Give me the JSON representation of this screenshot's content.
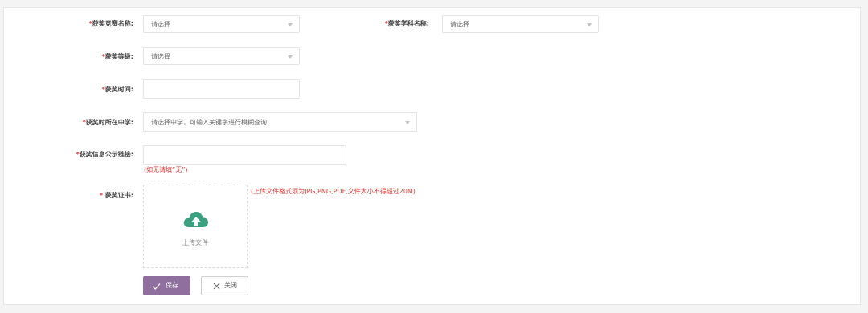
{
  "form": {
    "required_mark": "*",
    "competition": {
      "label": "获奖竞赛名称:",
      "placeholder": "请选择"
    },
    "subject": {
      "label": "获奖学科名称:",
      "placeholder": "请选择"
    },
    "level": {
      "label": "获奖等级:",
      "placeholder": "请选择"
    },
    "time": {
      "label": "获奖时间:",
      "value": ""
    },
    "school": {
      "label": "获奖时所在中学:",
      "placeholder": "请选择中学，可输入关键字进行模糊查询"
    },
    "link": {
      "label": "获奖信息公示链接:",
      "value": "",
      "hint": "(如无请填“无”)"
    },
    "certificate": {
      "label": "获奖证书:",
      "upload_text": "上传文件",
      "hint": "(上传文件格式须为JPG,PNG,PDF,文件大小不得超过20M)"
    }
  },
  "actions": {
    "save": "保存",
    "close": "关闭"
  },
  "colors": {
    "primary": "#8e6f9e",
    "required": "#e53935",
    "upload_icon": "#3aa07f"
  },
  "icons": {
    "save": "check-icon",
    "close": "close-icon",
    "upload": "cloud-upload-icon"
  }
}
